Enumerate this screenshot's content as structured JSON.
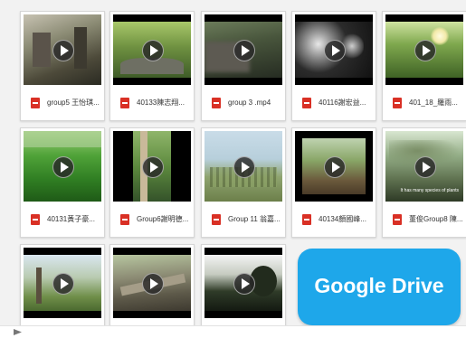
{
  "files": [
    {
      "name": "group5 王怡琪...",
      "caption": ""
    },
    {
      "name": "40133陳志翔...",
      "caption": ""
    },
    {
      "name": "group 3 .mp4",
      "caption": ""
    },
    {
      "name": "40116謝宏益...",
      "caption": ""
    },
    {
      "name": "401_18_羅雨...",
      "caption": ""
    },
    {
      "name": "40131黃子豪...",
      "caption": ""
    },
    {
      "name": "Group6謝明德...",
      "caption": ""
    },
    {
      "name": "Group 11 翁嘉...",
      "caption": ""
    },
    {
      "name": "40134顏國峰...",
      "caption": ""
    },
    {
      "name": "董俊Group8 陳...",
      "caption": "It has many species of plants"
    }
  ],
  "google_drive": {
    "label": "Google Drive"
  },
  "colors": {
    "accent": "#1ea7ea",
    "file_icon": "#d93025"
  },
  "icons": {
    "play": "play-icon",
    "file": "video-file-icon",
    "scroll": "scroll-arrow-icon"
  }
}
